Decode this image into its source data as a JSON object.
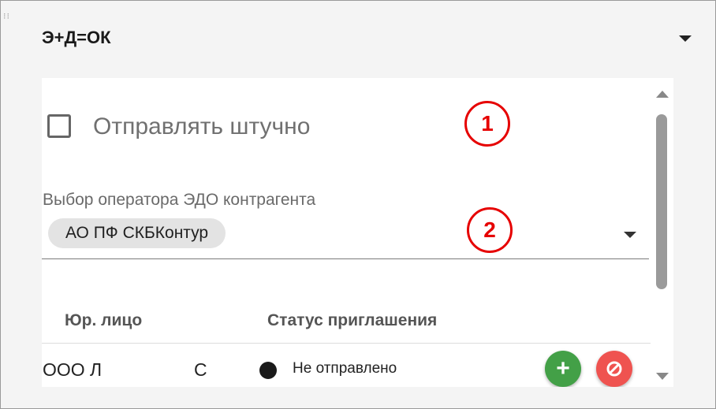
{
  "section": {
    "title": "Э+Д=ОК"
  },
  "options": {
    "send_individually_label": "Отправлять штучно"
  },
  "callouts": [
    "1",
    "2"
  ],
  "operator_select": {
    "label": "Выбор оператора ЭДО контрагента",
    "selected_chip": "АО ПФ СКБКонтур"
  },
  "table": {
    "headers": [
      "Юр. лицо",
      "Статус приглашения"
    ],
    "rows": [
      {
        "entity": "ООО Л",
        "col2": "С",
        "status": "Не отправлено"
      }
    ]
  },
  "icons": {
    "add": "plus-icon",
    "block": "block-icon",
    "collapse": "chevron-down-icon"
  },
  "colors": {
    "add_button": "#43a047",
    "block_button": "#ef5350",
    "callout": "#e60000",
    "status_dot": "#1a1a1a"
  }
}
